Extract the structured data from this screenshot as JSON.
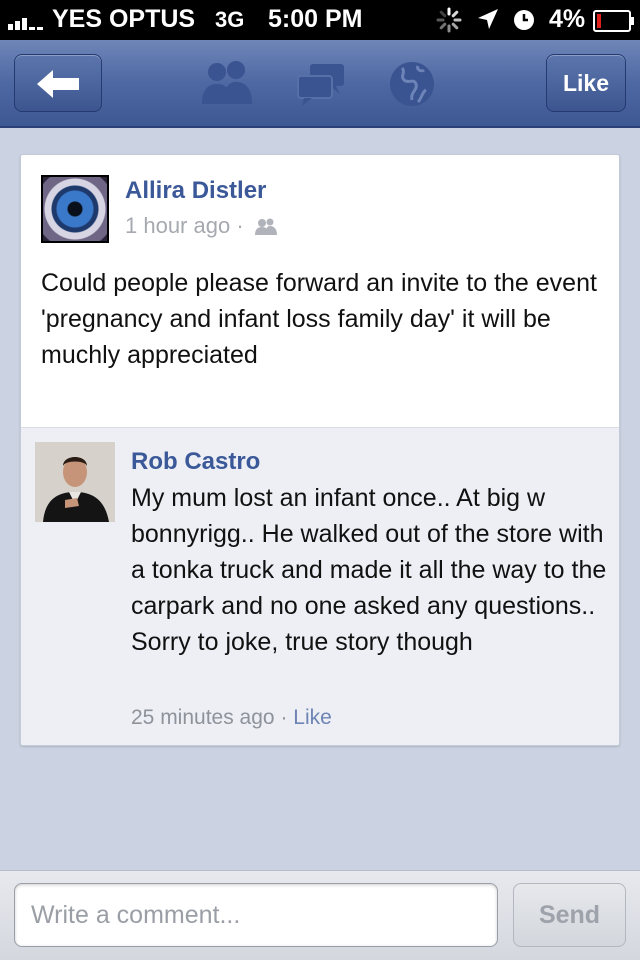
{
  "status_bar": {
    "carrier": "YES OPTUS",
    "network": "3G",
    "time": "5:00 PM",
    "battery": "4%",
    "icons": [
      "signal-icon",
      "activity-spinner-icon",
      "location-arrow-icon",
      "alarm-clock-icon",
      "battery-icon"
    ]
  },
  "nav": {
    "back_icon": "back-arrow-icon",
    "center_icons": [
      "friends-icon",
      "messages-icon",
      "notifications-globe-icon"
    ],
    "like_label": "Like"
  },
  "post": {
    "author": "Allira Distler",
    "time": "1 hour ago",
    "separator": "·",
    "audience_icon": "friends-audience-icon",
    "text": "Could people please forward an invite to the event 'pregnancy and infant loss family day' it will be muchly appreciated"
  },
  "comment": {
    "author": "Rob Castro",
    "text": "My mum lost an infant once.. At big w bonnyrigg.. He walked out of the store with a tonka truck and made it all the way to the carpark and no one asked any questions.. Sorry to joke, true story though",
    "time": "25 minutes ago",
    "separator": "·",
    "like_label": "Like"
  },
  "compose": {
    "placeholder": "Write a comment...",
    "value": "",
    "send_label": "Send"
  },
  "colors": {
    "nav_blue": "#4e68a3",
    "link_blue": "#3b5998",
    "background": "#cbd2e1",
    "battery_red": "#e0201b"
  }
}
